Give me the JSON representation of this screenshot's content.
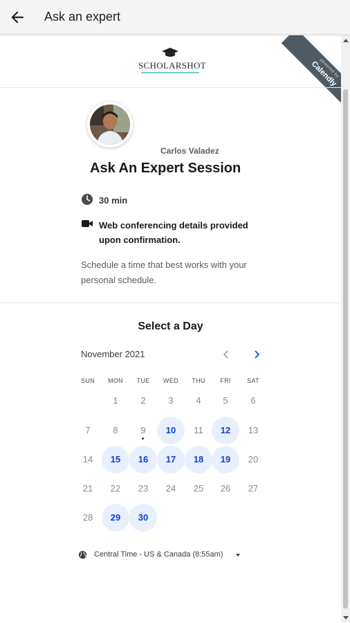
{
  "appbar": {
    "title": "Ask an expert",
    "back_icon": "arrow-left-icon"
  },
  "logo": {
    "text": "SCHOLARSHOT",
    "icon": "graduation-cap-icon",
    "accent": "#6dd3d0"
  },
  "ribbon": {
    "small_text": "powered by",
    "brand": "Calendly",
    "color": "#505a63"
  },
  "host": {
    "name": "Carlos Valadez"
  },
  "event": {
    "title": "Ask An Expert Session",
    "duration": "30 min",
    "conferencing": "Web conferencing details provided upon confirmation.",
    "description": "Schedule a time that best works with your personal schedule."
  },
  "calendar": {
    "heading": "Select a Day",
    "month": "November 2021",
    "weekdays": [
      "SUN",
      "MON",
      "TUE",
      "WED",
      "THU",
      "FRI",
      "SAT"
    ],
    "weeks": [
      [
        "",
        "1",
        "2",
        "3",
        "4",
        "5",
        "6"
      ],
      [
        "7",
        "8",
        "9",
        "10",
        "11",
        "12",
        "13"
      ],
      [
        "14",
        "15",
        "16",
        "17",
        "18",
        "19",
        "20"
      ],
      [
        "21",
        "22",
        "23",
        "24",
        "25",
        "26",
        "27"
      ],
      [
        "28",
        "29",
        "30",
        "",
        "",
        "",
        ""
      ]
    ],
    "available": [
      "10",
      "12",
      "15",
      "16",
      "17",
      "18",
      "19",
      "29",
      "30"
    ],
    "today": "9",
    "accent": "#0b3fd6",
    "available_bg": "#e8f0fd"
  },
  "timezone": {
    "label": "Central Time - US & Canada (8:55am)",
    "icon": "globe-icon"
  }
}
